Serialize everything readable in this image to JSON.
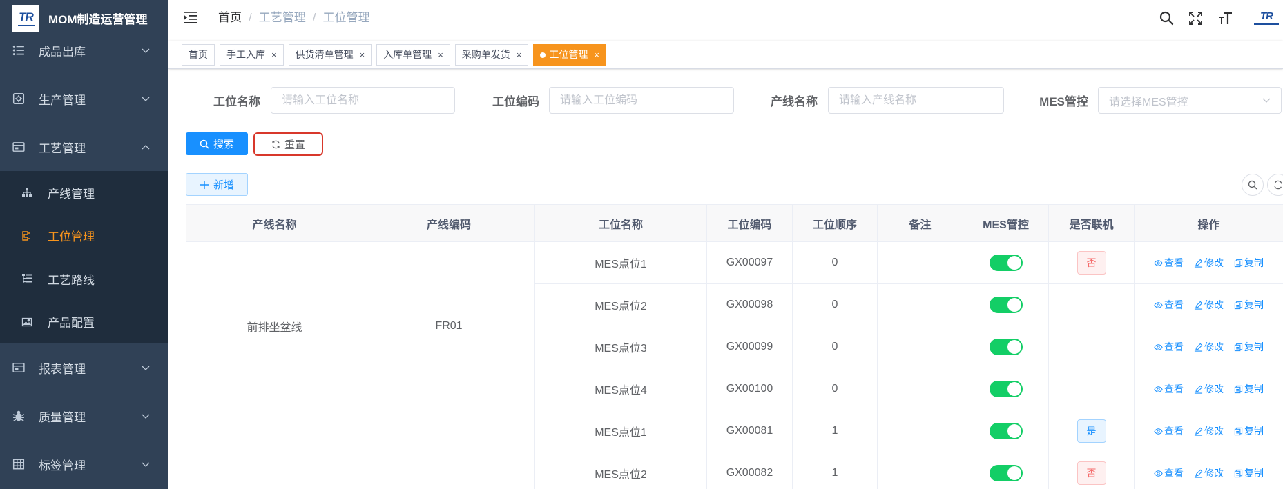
{
  "app": {
    "title": "MOM制造运营管理",
    "logo_text": "TR"
  },
  "sidebar": {
    "items": [
      {
        "label": "成品出库",
        "icon": "list-icon",
        "expanded": false
      },
      {
        "label": "生产管理",
        "icon": "production-icon",
        "expanded": false
      },
      {
        "label": "工艺管理",
        "icon": "process-icon",
        "expanded": true,
        "children": [
          {
            "label": "产线管理",
            "icon": "tree-icon",
            "active": false
          },
          {
            "label": "工位管理",
            "icon": "station-icon",
            "active": true
          },
          {
            "label": "工艺路线",
            "icon": "route-icon",
            "active": false
          },
          {
            "label": "产品配置",
            "icon": "image-icon",
            "active": false
          }
        ]
      },
      {
        "label": "报表管理",
        "icon": "report-icon",
        "expanded": false
      },
      {
        "label": "质量管理",
        "icon": "bug-icon",
        "expanded": false
      },
      {
        "label": "标签管理",
        "icon": "table-icon",
        "expanded": false
      }
    ]
  },
  "header": {
    "breadcrumb": [
      "首页",
      "工艺管理",
      "工位管理"
    ],
    "separator": "/",
    "icons": [
      "menu-fold-icon",
      "search-icon",
      "fullscreen-icon",
      "font-size-icon"
    ],
    "logo_text": "TR"
  },
  "tags": {
    "close_glyph": "×",
    "items": [
      {
        "label": "首页",
        "closable": false,
        "active": false
      },
      {
        "label": "手工入库",
        "closable": true,
        "active": false
      },
      {
        "label": "供货清单管理",
        "closable": true,
        "active": false
      },
      {
        "label": "入库单管理",
        "closable": true,
        "active": false
      },
      {
        "label": "采购单发货",
        "closable": true,
        "active": false
      },
      {
        "label": "工位管理",
        "closable": true,
        "active": true
      }
    ]
  },
  "search": {
    "fields": [
      {
        "label": "工位名称",
        "placeholder": "请输入工位名称",
        "value": ""
      },
      {
        "label": "工位编码",
        "placeholder": "请输入工位编码",
        "value": ""
      },
      {
        "label": "产线名称",
        "placeholder": "请输入产线名称",
        "value": ""
      },
      {
        "label": "MES管控",
        "placeholder": "请选择MES管控",
        "value": "",
        "type": "select"
      }
    ],
    "search_button": "搜索",
    "reset_button": "重置"
  },
  "toolbar": {
    "add_button": "新增",
    "icons": [
      "search-icon",
      "refresh-icon"
    ]
  },
  "table": {
    "columns": [
      "产线名称",
      "产线编码",
      "工位名称",
      "工位编码",
      "工位顺序",
      "备注",
      "MES管控",
      "是否联机",
      "操作"
    ],
    "actions": [
      {
        "label": "查看",
        "icon": "eye-icon"
      },
      {
        "label": "修改",
        "icon": "edit-icon"
      },
      {
        "label": "复制",
        "icon": "copy-icon"
      }
    ],
    "groups": [
      {
        "line_name": "前排坐盆线",
        "line_code": "FR01",
        "rows": [
          {
            "station_name": "MES点位1",
            "station_code": "GX00097",
            "sequence": 0,
            "remark": "",
            "mes_control": true,
            "online": "否"
          },
          {
            "station_name": "MES点位2",
            "station_code": "GX00098",
            "sequence": 0,
            "remark": "",
            "mes_control": true
          },
          {
            "station_name": "MES点位3",
            "station_code": "GX00099",
            "sequence": 0,
            "remark": "",
            "mes_control": true
          },
          {
            "station_name": "MES点位4",
            "station_code": "GX00100",
            "sequence": 0,
            "remark": "",
            "mes_control": true
          }
        ]
      },
      {
        "line_name": "",
        "line_code": "",
        "rows": [
          {
            "station_name": "MES点位1",
            "station_code": "GX00081",
            "sequence": 1,
            "remark": "",
            "mes_control": true,
            "online": "是"
          },
          {
            "station_name": "MES点位2",
            "station_code": "GX00082",
            "sequence": 1,
            "remark": "",
            "mes_control": true,
            "online": "否"
          }
        ]
      }
    ]
  },
  "colors": {
    "sidebar_bg": "#304156",
    "submenu_bg": "#1f2d3d",
    "accent": "#f7941d",
    "primary": "#1890ff",
    "switch_on": "#13ce66",
    "danger": "#f56c6c"
  }
}
